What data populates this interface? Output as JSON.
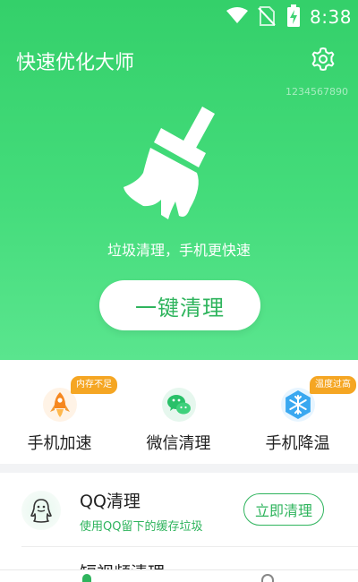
{
  "status_bar": {
    "time": "8:38",
    "icons": [
      "wifi-icon",
      "no-sim-icon",
      "battery-charging-icon"
    ]
  },
  "header": {
    "title": "快速优化大师",
    "settings_icon": "gear-icon",
    "device_id": "1234567890"
  },
  "hero": {
    "illustration": "broom-icon",
    "slogan": "垃圾清理，手机更快速",
    "clean_button": "一键清理"
  },
  "features": [
    {
      "label": "手机加速",
      "icon": "rocket-icon",
      "badge": "内存不足"
    },
    {
      "label": "微信清理",
      "icon": "wechat-icon",
      "badge": ""
    },
    {
      "label": "手机降温",
      "icon": "snowflake-icon",
      "badge": "温度过高"
    }
  ],
  "list": [
    {
      "title": "QQ清理",
      "subtitle": "使用QQ留下的缓存垃圾",
      "action": "立即清理",
      "icon": "qq-penguin-icon"
    },
    {
      "title": "短视频清理",
      "subtitle": "",
      "action": "",
      "icon": "video-icon"
    }
  ],
  "colors": {
    "primary": "#2fb45d",
    "hero_top": "#34d06a",
    "hero_bottom": "#5ae58e",
    "badge": "#f5a623"
  }
}
